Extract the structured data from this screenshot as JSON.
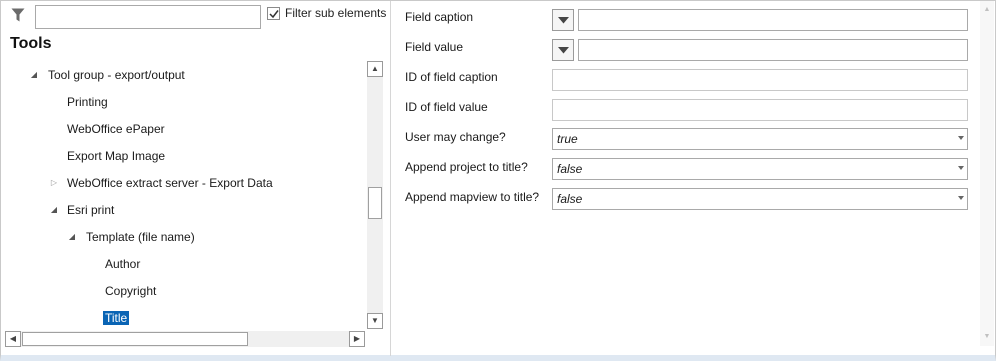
{
  "left_panel": {
    "search": {
      "value": "",
      "placeholder": ""
    },
    "filter_sub_elements": {
      "label": "Filter sub elements",
      "checked": true
    },
    "title": "Tools",
    "tree": [
      {
        "label": "Tool group - export/output",
        "expander": "expanded",
        "selected": false
      },
      {
        "label": "Printing",
        "expander": "none",
        "selected": false
      },
      {
        "label": "WebOffice ePaper",
        "expander": "none",
        "selected": false
      },
      {
        "label": "Export Map Image",
        "expander": "none",
        "selected": false
      },
      {
        "label": "WebOffice extract server - Export Data",
        "expander": "collapsed",
        "selected": false
      },
      {
        "label": "Esri print",
        "expander": "expanded",
        "selected": false
      },
      {
        "label": "Template (file name)",
        "expander": "expanded",
        "selected": false
      },
      {
        "label": "Author",
        "expander": "none",
        "selected": false
      },
      {
        "label": "Copyright",
        "expander": "none",
        "selected": false
      },
      {
        "label": "Title",
        "expander": "none",
        "selected": true
      }
    ]
  },
  "right_panel": {
    "field_caption": {
      "label": "Field caption",
      "value": ""
    },
    "field_value": {
      "label": "Field value",
      "value": ""
    },
    "id_field_caption": {
      "label": "ID of field caption",
      "value": ""
    },
    "id_field_value": {
      "label": "ID of field value",
      "value": ""
    },
    "user_may_change": {
      "label": "User may change?",
      "value": "true"
    },
    "append_project": {
      "label": "Append project to title?",
      "value": "false"
    },
    "append_mapview": {
      "label": "Append mapview to title?",
      "value": "false"
    }
  },
  "colors": {
    "selection": "#0a64b4",
    "border": "#a9a9a9"
  },
  "icons": [
    "filter-icon",
    "checkbox-check-icon",
    "chevron-down-icon",
    "expand-arrow-icon",
    "collapse-arrow-icon"
  ]
}
